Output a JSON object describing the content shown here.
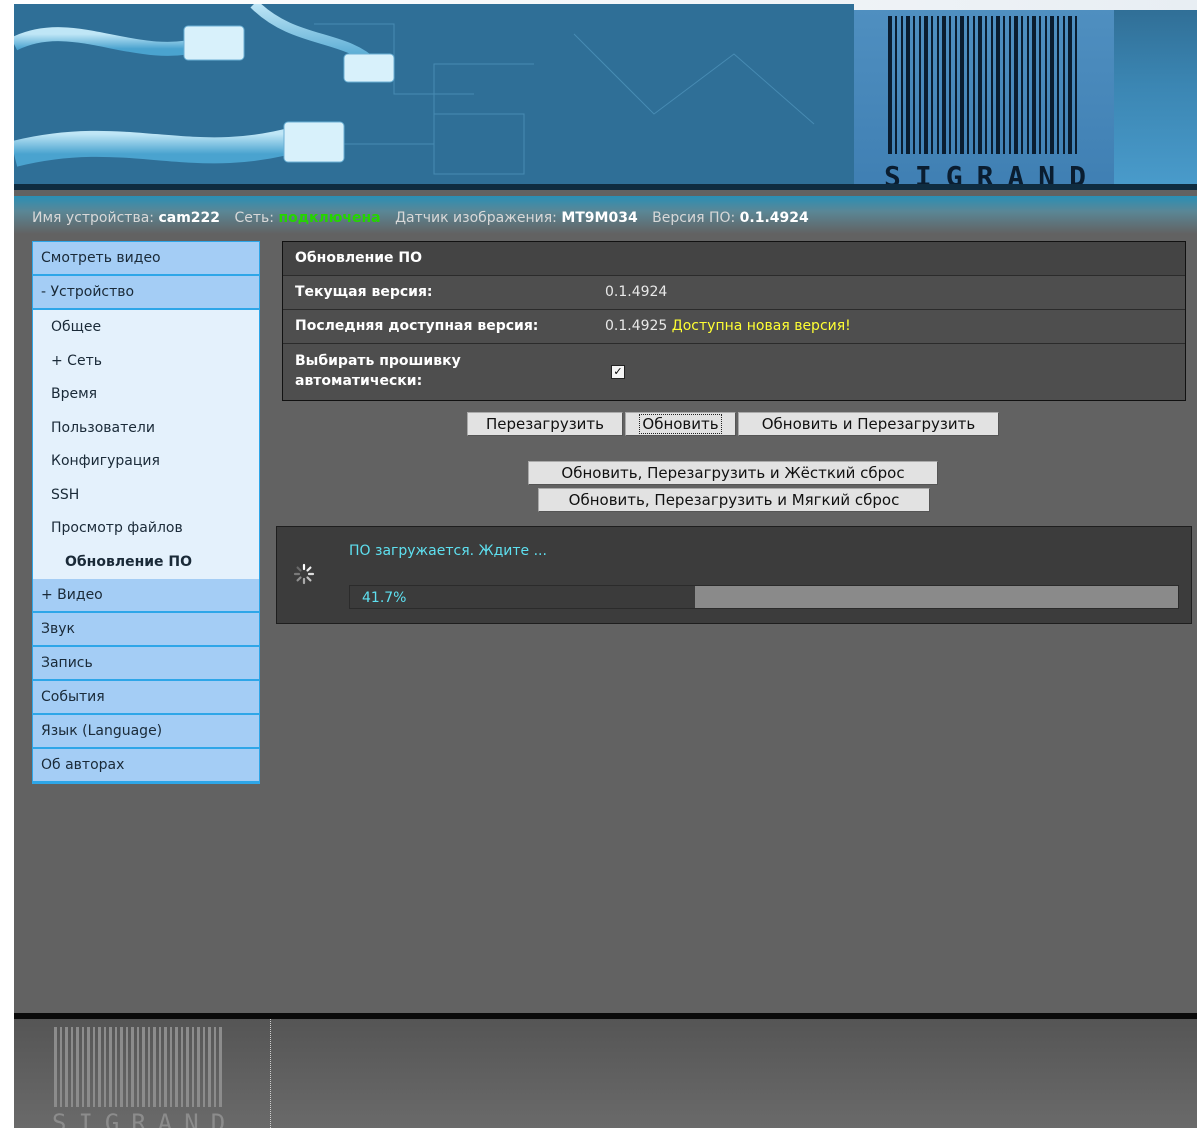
{
  "banner": {
    "logo_text": "SIGRAND"
  },
  "status": {
    "device_label": "Имя устройства:",
    "device_value": "cam222",
    "network_label": "Сеть:",
    "network_value": "подключена",
    "sensor_label": "Датчик изображения:",
    "sensor_value": "MT9M034",
    "version_label": "Версия ПО:",
    "version_value": "0.1.4924",
    "network_color": "#25d400"
  },
  "sidebar": {
    "items": [
      "Смотреть видео",
      "- Устройство",
      "Общее",
      "+ Сеть",
      "Время",
      "Пользователи",
      "Конфигурация",
      "SSH",
      "Просмотр файлов",
      "Обновление ПО",
      "+ Видео",
      "Звук",
      "Запись",
      "События",
      "Язык (Language)",
      "Об авторах"
    ]
  },
  "firmware": {
    "title": "Обновление ПО",
    "current_label": "Текущая версия:",
    "current_value": "0.1.4924",
    "latest_label": "Последняя доступная версия:",
    "latest_value": "0.1.4925",
    "latest_note": "Доступна новая версия!",
    "auto_label": "Выбирать прошивку автоматически:",
    "auto_checked": true,
    "checkmark": "✓"
  },
  "buttons": {
    "reboot": "Перезагрузить",
    "update": "Обновить",
    "update_reboot": "Обновить и Перезагрузить",
    "update_reboot_hard": "Обновить, Перезагрузить и Жёсткий сброс",
    "update_reboot_soft": "Обновить, Перезагрузить и Мягкий сброс"
  },
  "progress": {
    "message": "ПО загружается. Ждите ...",
    "percent_text": "41.7%",
    "fraction": 0.417
  },
  "footer": {
    "logo_text": "SIGRAND"
  },
  "colors": {
    "accent_cyan": "#5ee0f0",
    "notice_yellow": "#ffff33",
    "sidebar_blue": "#a4cdf5"
  }
}
